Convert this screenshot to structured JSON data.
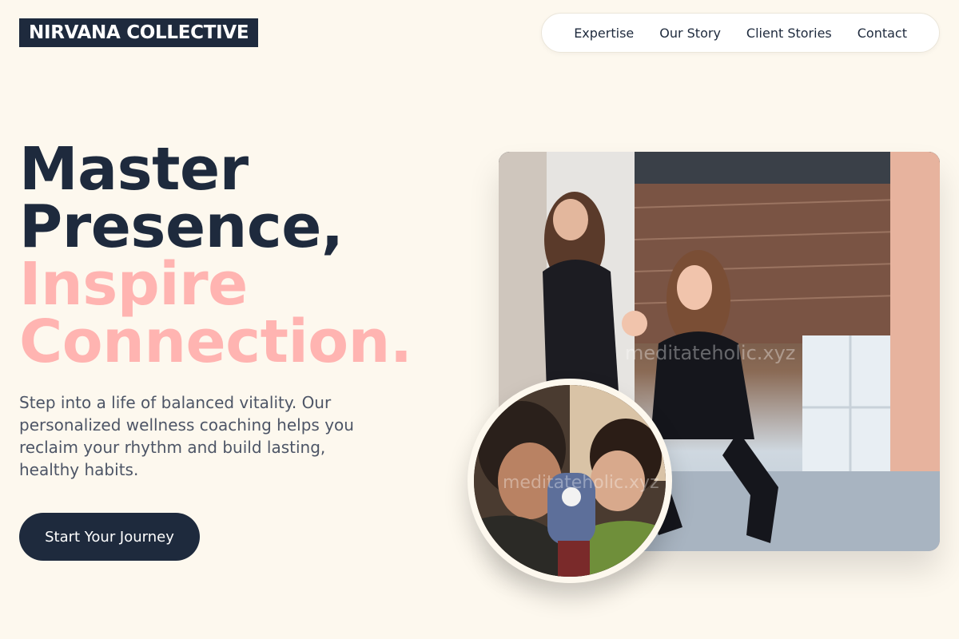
{
  "brand": {
    "name": "NIRVANA COLLECTIVE"
  },
  "nav": {
    "items": [
      {
        "label": "Expertise"
      },
      {
        "label": "Our Story"
      },
      {
        "label": "Client Stories"
      },
      {
        "label": "Contact"
      }
    ]
  },
  "hero": {
    "line1": "Master",
    "line2": "Presence,",
    "line3": "Inspire",
    "line4": "Connection.",
    "lede": "Step into a life of balanced vitality. Our personalized wellness coaching helps you reclaim your rhythm and build lasting, healthy habits.",
    "cta_label": "Start Your Journey"
  },
  "media": {
    "main_watermark": "meditateholic.xyz",
    "circle_watermark": "meditateholic.xyz"
  },
  "colors": {
    "background": "#fdf8ee",
    "navy": "#1e2a3d",
    "pink": "#ffb4b1",
    "body_text": "#4d5566"
  }
}
